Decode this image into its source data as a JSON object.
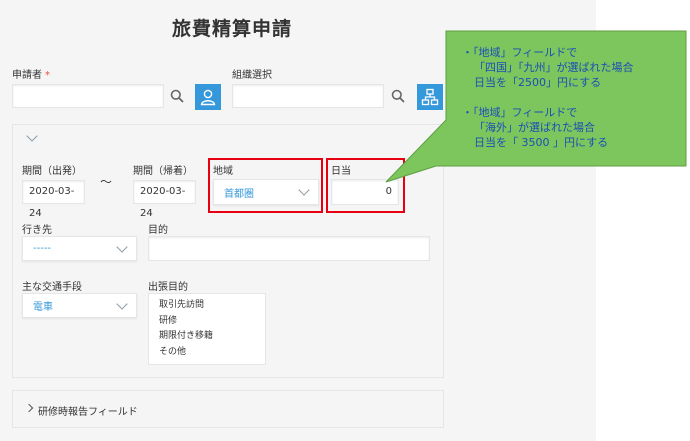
{
  "form": {
    "title": "旅費精算申請",
    "applicant": {
      "label": "申請者",
      "required_mark": "*",
      "value": ""
    },
    "org": {
      "label": "組織選択",
      "value": ""
    },
    "period_start": {
      "label": "期間（出発）",
      "value": "2020-03-24"
    },
    "tilde": "～",
    "period_end": {
      "label": "期間（帰着）",
      "value": "2020-03-24"
    },
    "region": {
      "label": "地域",
      "value": "首都圏"
    },
    "daily": {
      "label": "日当",
      "value": "0"
    },
    "destination": {
      "label": "行き先",
      "value": "-----"
    },
    "purpose": {
      "label": "目的",
      "value": ""
    },
    "transport": {
      "label": "主な交通手段",
      "value": "電車"
    },
    "trip_purpose": {
      "label": "出張目的",
      "options": [
        "取引先訪問",
        "研修",
        "期限付き移籍",
        "その他"
      ]
    },
    "training_section": {
      "label": "研修時報告フィールド"
    }
  },
  "callout": {
    "line1": "・「地域」フィールドで",
    "line2": "「四国」「九州」が選ばれた場合",
    "line3": "日当を「2500」円にする",
    "line4": "・「地域」フィールドで",
    "line5": "「海外」が選ばれた場合",
    "line6": "日当を「 3500 」円にする"
  },
  "colors": {
    "accent": "#3498db",
    "highlight": "#e60012",
    "callout_bg": "#7dc65e",
    "callout_text": "#1a4fb5"
  },
  "icons": [
    "search-icon",
    "user-icon",
    "org-chart-icon",
    "chevron-down-icon",
    "chevron-right-icon"
  ]
}
